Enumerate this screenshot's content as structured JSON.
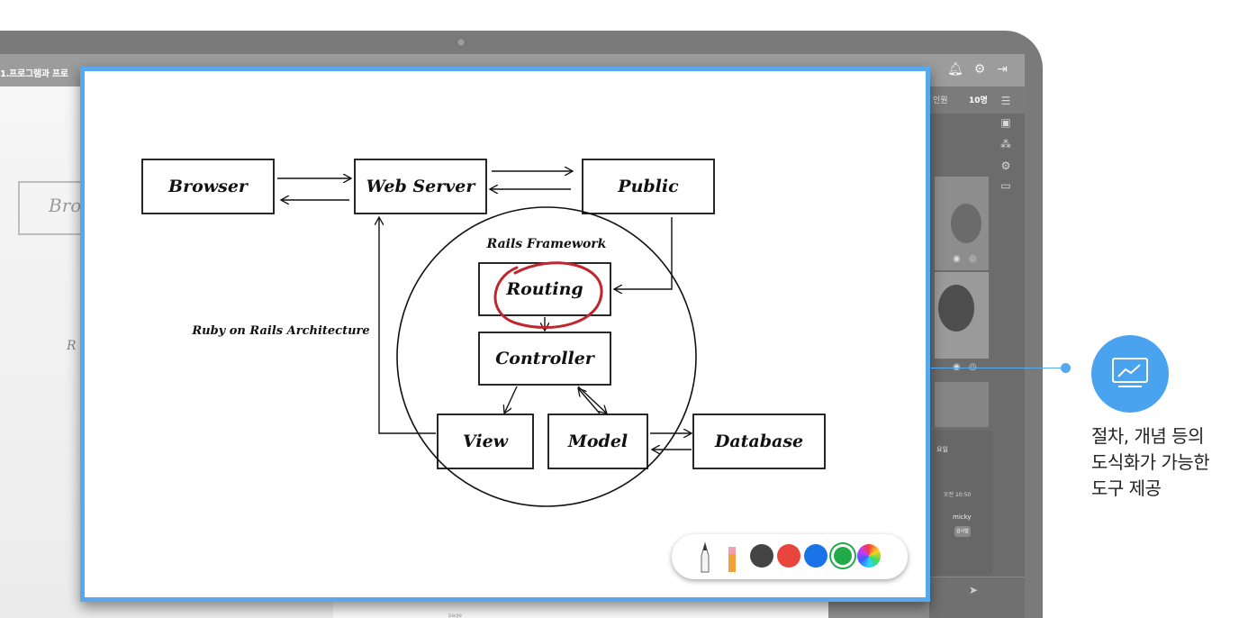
{
  "app": {
    "doc_title": "1.프로그램과 프로",
    "participants_label": "인원",
    "participants_count": "10명"
  },
  "background_doc": {
    "partial_box_text": "Bro",
    "partial_text": "R",
    "page_number": "page"
  },
  "chat": {
    "label": "요일",
    "time": "오전 10:50",
    "user": "micky",
    "bubble": "감사합니다."
  },
  "diagram": {
    "nodes": {
      "browser": "Browser",
      "web_server": "Web Server",
      "public": "Public",
      "routing": "Routing",
      "controller": "Controller",
      "view": "View",
      "model": "Model",
      "database": "Database"
    },
    "framework_label": "Rails Framework",
    "architecture_label": "Ruby on Rails Architecture"
  },
  "toolbar": {
    "tools": [
      "pen",
      "highlighter"
    ],
    "colors": [
      "#444444",
      "#e8453c",
      "#1a73e8",
      "#22a94a",
      "rainbow"
    ],
    "selected_color": "#22a94a"
  },
  "callout": {
    "icon": "chart-board-icon",
    "caption": [
      "절차, 개념 등의",
      "도식화가 가능한",
      "도구 제공"
    ]
  }
}
